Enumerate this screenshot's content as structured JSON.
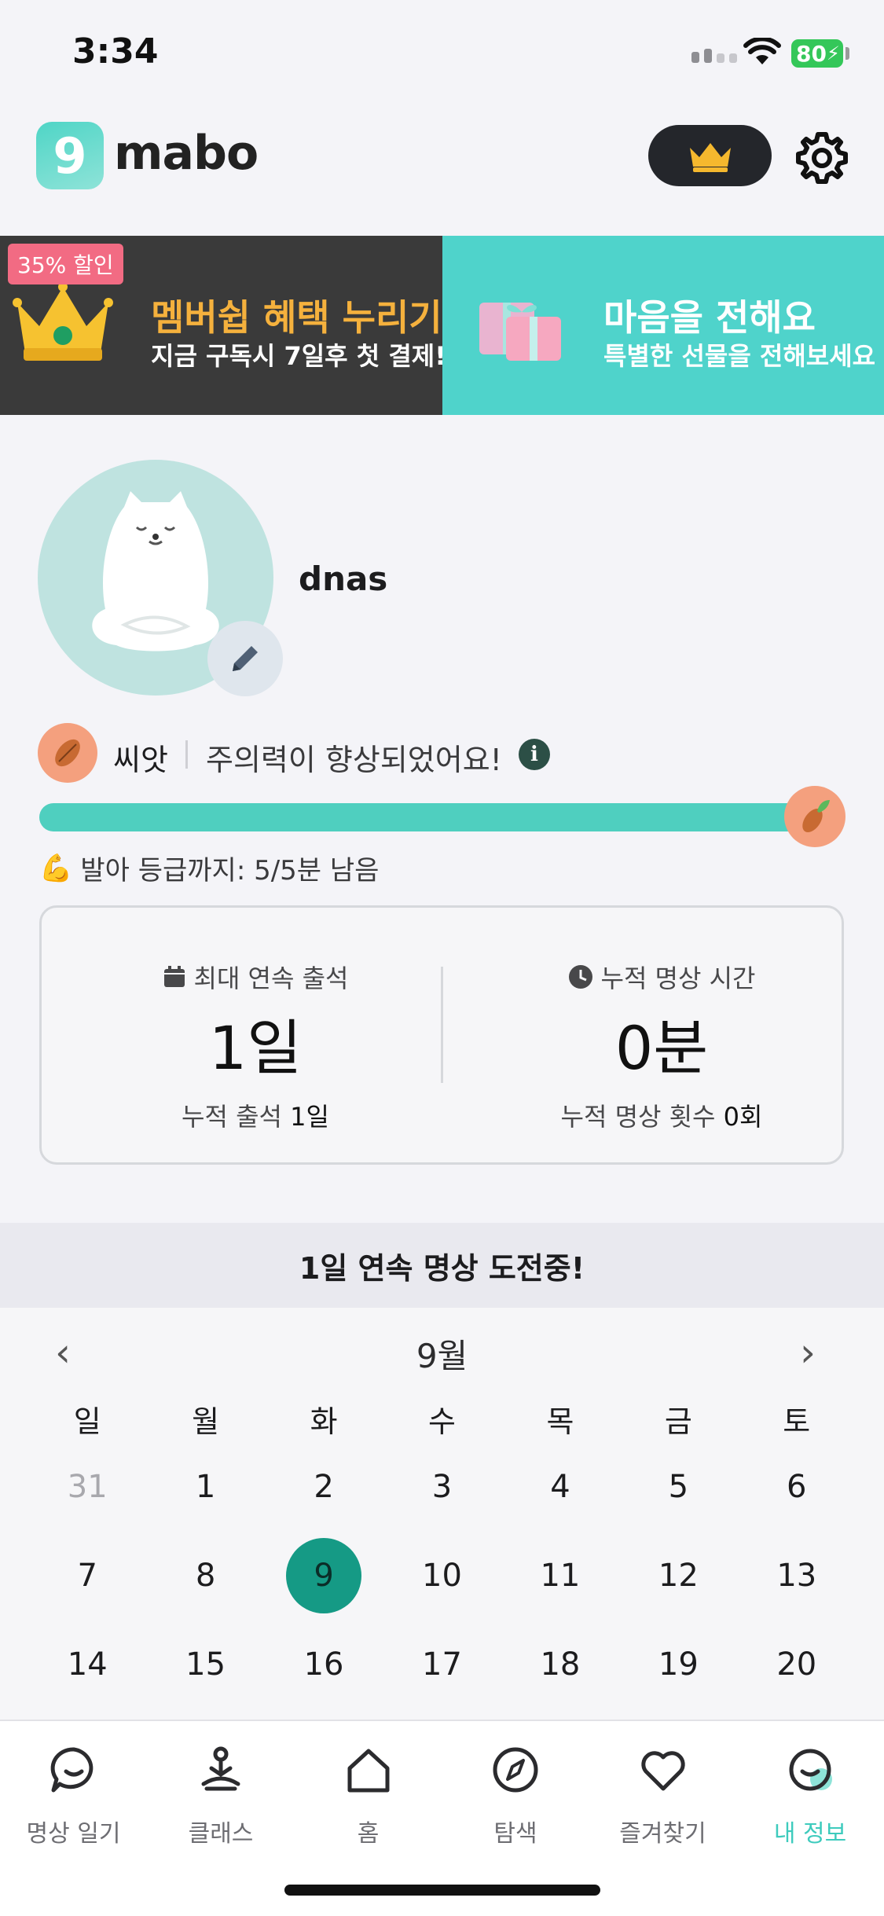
{
  "status": {
    "time": "3:34",
    "battery": "80"
  },
  "header": {
    "logo_glyph": "9",
    "logo_text": "mabo"
  },
  "banners": {
    "left": {
      "badge": "35% 할인",
      "title": "멤버쉽 혜택 누리기",
      "subtitle": "지금 구독시 7일후 첫 결제!"
    },
    "right": {
      "title": "마음을 전해요",
      "subtitle": "특별한 선물을 전해보세요"
    }
  },
  "profile": {
    "username": "dnas",
    "level_name": "씨앗",
    "level_desc": "주의력이 향상되었어요!",
    "progress_fraction": 1.0,
    "next_level": "발아 등급까지: 5/5분 남음"
  },
  "stats": {
    "left": {
      "label": "최대 연속 출석",
      "value": "1일",
      "sub_label": "누적 출석",
      "sub_value": "1일"
    },
    "right": {
      "label": "누적 명상 시간",
      "value": "0분",
      "sub_label": "누적 명상 횟수",
      "sub_value": "0회"
    }
  },
  "streak": {
    "text": "1일 연속 명상 도전중!"
  },
  "calendar": {
    "prev": "‹",
    "next": "›",
    "month": "9월",
    "weekdays": [
      "일",
      "월",
      "화",
      "수",
      "목",
      "금",
      "토"
    ],
    "days": [
      "31",
      "1",
      "2",
      "3",
      "4",
      "5",
      "6",
      "7",
      "8",
      "9",
      "10",
      "11",
      "12",
      "13",
      "14",
      "15",
      "16",
      "17",
      "18",
      "19",
      "20"
    ],
    "muted": [
      "31"
    ],
    "today": "9"
  },
  "tabs": [
    {
      "label": "명상 일기",
      "icon": "chat-smile-icon"
    },
    {
      "label": "클래스",
      "icon": "meditation-icon"
    },
    {
      "label": "홈",
      "icon": "home-icon"
    },
    {
      "label": "탐색",
      "icon": "compass-icon"
    },
    {
      "label": "즐겨찾기",
      "icon": "heart-icon"
    },
    {
      "label": "내 정보",
      "icon": "profile-smile-icon",
      "active": true
    }
  ],
  "colors": {
    "accent": "#4fcfbf",
    "today": "#159a85",
    "banner_left": "#3a3a3a",
    "banner_right": "#4fd3cb",
    "gold": "#f5b13d"
  }
}
